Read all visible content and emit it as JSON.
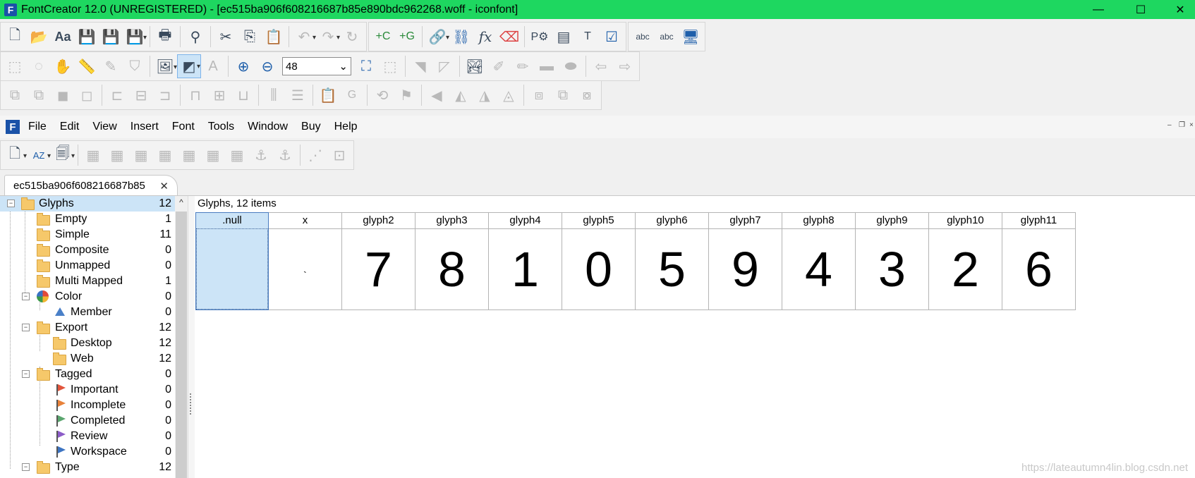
{
  "window": {
    "app_icon_text": "F",
    "title": "FontCreator 12.0 (UNREGISTERED) - [ec515ba906f608216687b85e890bdc962268.woff - iconfont]",
    "minimize": "—",
    "maximize": "☐",
    "close": "✕"
  },
  "toolbar1": [
    "new-file",
    "open-folder",
    "font-properties",
    "save",
    "save-all",
    "save-as",
    "print",
    "find",
    "cut",
    "copy",
    "paste",
    "undo",
    "redo",
    "refresh",
    "new-composite",
    "new-glyph",
    "link",
    "unlink",
    "formula",
    "eraser",
    "preview-properties",
    "glyph-preview",
    "text-transform",
    "validate",
    "spell-check",
    "abc-web",
    "monitor"
  ],
  "zoom": {
    "value": "48",
    "arrow": "⌄"
  },
  "menu": {
    "icon_text": "F",
    "items": [
      "File",
      "Edit",
      "View",
      "Insert",
      "Font",
      "Tools",
      "Window",
      "Buy",
      "Help"
    ],
    "mdi_min": "–",
    "mdi_restore": "❐",
    "mdi_close": "×"
  },
  "tab": {
    "label": "ec515ba906f608216687b85",
    "close": "✕"
  },
  "tree": [
    {
      "label": "Glyphs",
      "count": "12"
    },
    {
      "label": "Empty",
      "count": "1"
    },
    {
      "label": "Simple",
      "count": "11"
    },
    {
      "label": "Composite",
      "count": "0"
    },
    {
      "label": "Unmapped",
      "count": "0"
    },
    {
      "label": "Multi Mapped",
      "count": "1"
    },
    {
      "label": "Color",
      "count": "0"
    },
    {
      "label": "Member",
      "count": "0"
    },
    {
      "label": "Export",
      "count": "12"
    },
    {
      "label": "Desktop",
      "count": "12"
    },
    {
      "label": "Web",
      "count": "12"
    },
    {
      "label": "Tagged",
      "count": "0"
    },
    {
      "label": "Important",
      "count": "0"
    },
    {
      "label": "Incomplete",
      "count": "0"
    },
    {
      "label": "Completed",
      "count": "0"
    },
    {
      "label": "Review",
      "count": "0"
    },
    {
      "label": "Workspace",
      "count": "0"
    },
    {
      "label": "Type",
      "count": "12"
    }
  ],
  "expanders": {
    "open": "−"
  },
  "scroll_up": "^",
  "glyphs": {
    "caption": "Glyphs, 12 items",
    "cells": [
      {
        "name": ".null",
        "char": ""
      },
      {
        "name": "x",
        "char": "`"
      },
      {
        "name": "glyph2",
        "char": "7"
      },
      {
        "name": "glyph3",
        "char": "8"
      },
      {
        "name": "glyph4",
        "char": "1"
      },
      {
        "name": "glyph5",
        "char": "0"
      },
      {
        "name": "glyph6",
        "char": "5"
      },
      {
        "name": "glyph7",
        "char": "9"
      },
      {
        "name": "glyph8",
        "char": "4"
      },
      {
        "name": "glyph9",
        "char": "3"
      },
      {
        "name": "glyph10",
        "char": "2"
      },
      {
        "name": "glyph11",
        "char": "6"
      }
    ]
  },
  "colors": {
    "titlebar": "#1ed760",
    "selection": "#cce4f7",
    "flag_important": "#e2553c",
    "flag_incomplete": "#e8823a",
    "flag_completed": "#5aa66e",
    "flag_review": "#8c5cc8",
    "flag_workspace": "#3d74c2",
    "member_icon": "#4a80c8"
  },
  "watermark": "https://lateautumn4lin.blog.csdn.net"
}
